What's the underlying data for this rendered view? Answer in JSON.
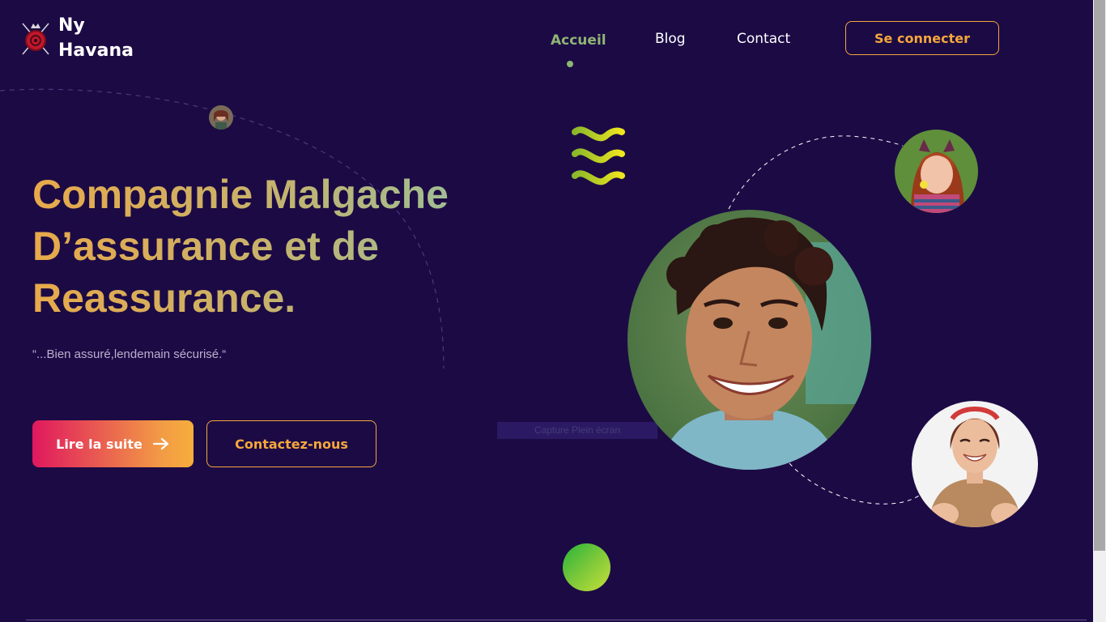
{
  "brand": {
    "line1": "Ny",
    "line2": "Havana",
    "emblem_icon": "shield-emblem-icon"
  },
  "nav": {
    "items": [
      {
        "label": "Accueil",
        "active": true
      },
      {
        "label": "Blog",
        "active": false
      },
      {
        "label": "Contact",
        "active": false
      }
    ],
    "login_label": "Se connecter"
  },
  "hero": {
    "title_line1": "Compagnie Malgache",
    "title_line2": "D’assurance et de",
    "title_line3": "Reassurance.",
    "quote": "“...Bien assuré,lendemain sécurisé.“",
    "primary_button": "Lire la suite",
    "secondary_button": "Contactez-nous"
  },
  "overlay": {
    "capture_tooltip": "Capture Plein écran"
  },
  "colors": {
    "background": "#1c0a45",
    "accent_orange": "#f4a73b",
    "accent_green": "#8fb574",
    "gradient_pink": "#e0185e",
    "wave_yellow": "#e0e020"
  },
  "images": {
    "hero_portrait": "smiling-young-man-curly-hair-photo",
    "top_avatar": "girl-with-flower-photo",
    "bottom_avatar": "laughing-woman-headband-photo",
    "small_avatar": "small-woman-avatar-photo"
  }
}
